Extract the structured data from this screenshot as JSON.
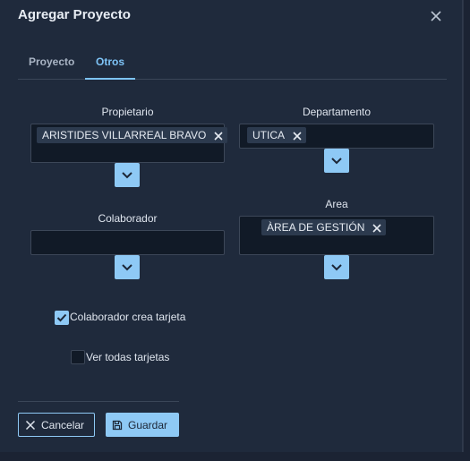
{
  "dialog": {
    "title": "Agregar Proyecto"
  },
  "tabs": [
    {
      "label": "Proyecto",
      "active": false
    },
    {
      "label": "Otros",
      "active": true
    }
  ],
  "fields": {
    "propietario": {
      "label": "Propietario",
      "selected": [
        "ARISTIDES VILLARREAL BRAVO"
      ]
    },
    "departamento": {
      "label": "Departamento",
      "selected": [
        "UTICA"
      ]
    },
    "colaborador": {
      "label": "Colaborador",
      "selected": []
    },
    "area": {
      "label": "Area",
      "selected": [
        "ÀREA DE GESTIÓN"
      ]
    }
  },
  "checkboxes": {
    "colaborador_crea_tarjeta": {
      "label": "Colaborador crea tarjeta",
      "checked": true
    },
    "ver_todas_tarjetas": {
      "label": "Ver todas tarjetas",
      "checked": false
    }
  },
  "buttons": {
    "cancel": "Cancelar",
    "save": "Guardar"
  },
  "colors": {
    "accent": "#8ec9f5",
    "tab_active": "#7ec4f7",
    "dialog_bg": "#1f2a3c",
    "field_bg": "#111a27"
  }
}
